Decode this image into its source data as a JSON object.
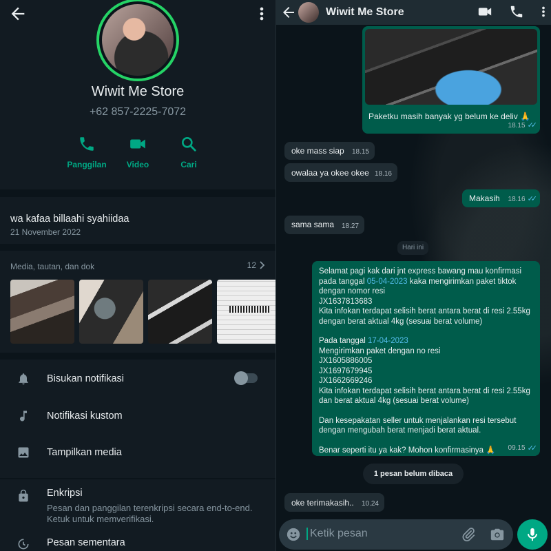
{
  "contact": {
    "name": "Wiwit Me Store",
    "phone": "+62 857-2225-7072",
    "actions": [
      {
        "label": "Panggilan",
        "icon": "phone-icon"
      },
      {
        "label": "Video",
        "icon": "video-icon"
      },
      {
        "label": "Cari",
        "icon": "search-icon"
      }
    ],
    "about": {
      "text": "wa kafaa billaahi syahiidaa",
      "date": "21 November 2022"
    },
    "media": {
      "heading": "Media, tautan, dan dok",
      "count": "12"
    },
    "settings": [
      {
        "label": "Bisukan notifikasi",
        "icon": "bell-icon"
      },
      {
        "label": "Notifikasi kustom",
        "icon": "music-note-icon"
      },
      {
        "label": "Tampilkan media",
        "icon": "image-icon"
      }
    ],
    "encryption": {
      "title": "Enkripsi",
      "subtitle": "Pesan dan panggilan terenkripsi secara end-to-end. Ketuk untuk memverifikasi."
    },
    "disappearing": {
      "title": "Pesan sementara"
    }
  },
  "chat": {
    "header_name": "Wiwit Me Store",
    "messages": [
      {
        "dir": "out",
        "text": "Paketku masih banyak yg belum ke deliv 🙏",
        "time": "18.15",
        "has_image": true
      },
      {
        "dir": "in",
        "text": "oke mass siap",
        "time": "18.15"
      },
      {
        "dir": "in",
        "text": "owalaa ya okee okee",
        "time": "18.16"
      },
      {
        "dir": "out",
        "text": "Makasih",
        "time": "18.16"
      },
      {
        "dir": "in",
        "text": "sama sama",
        "time": "18.27"
      },
      {
        "dir": "in",
        "text": "oke terimakasih..",
        "time": "10.24"
      }
    ],
    "day_divider": "Hari ini",
    "long_message": {
      "line1": "Selamat pagi kak dari jnt express bawang mau konfirmasi",
      "line2_prefix": "pada tanggal ",
      "date1": "05-04-2023",
      "line2_suffix": " kaka mengirimkan paket tiktok",
      "line3": "dengan nomor resi",
      "line4": "JX1637813683",
      "line5": "Kita infokan terdapat selisih berat antara berat di resi 2.55kg",
      "line6": "dengan berat aktual 4kg (sesuai berat volume)",
      "line7_prefix": "Pada tanggal ",
      "date2": "17-04-2023",
      "line8": "Mengirimkan paket dengan no resi",
      "line9": "JX1605886005",
      "line10": "JX1697679945",
      "line11": "JX1662669246",
      "line12": "Kita infokan terdapat selisih berat antara berat di resi 2.55kg",
      "line13": "dan berat aktual 4kg (sesuai berat volume)",
      "line14": "Dan kesepakatan seller untuk menjalankan resi tersebut",
      "line15": "dengan mengubah berat menjadi berat aktual.",
      "line16": "Benar seperti itu ya kak? Mohon konfirmasinya 🙏",
      "time": "09.15"
    },
    "unread_badge": "1 pesan belum dibaca",
    "input_placeholder": "Ketik pesan"
  },
  "colors": {
    "accent": "#00a884",
    "outgoing": "#005c4b",
    "incoming": "#202c33",
    "ring": "#25d366",
    "link": "#53bdeb"
  }
}
